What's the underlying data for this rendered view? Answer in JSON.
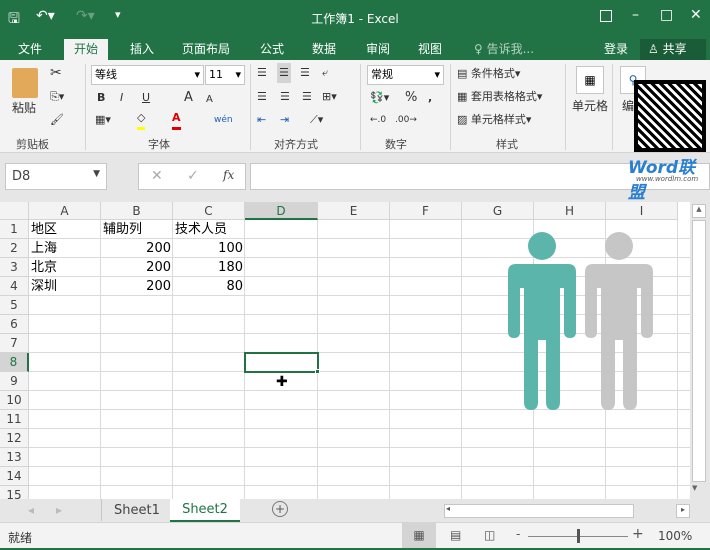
{
  "title": "工作簿1 - Excel",
  "quick_access": {
    "save": "save-icon",
    "undo": "undo-icon",
    "redo": "redo-icon",
    "customize": "▾"
  },
  "window": {
    "restore_ribbon": "ribbon-display-icon",
    "minimize": "–",
    "maximize": "□",
    "close": "✕"
  },
  "tabs": [
    "文件",
    "开始",
    "插入",
    "页面布局",
    "公式",
    "数据",
    "审阅",
    "视图"
  ],
  "tell_me": "告诉我...",
  "login": "登录",
  "share": "共享",
  "ribbon": {
    "clipboard": {
      "paste": "粘贴",
      "label": "剪贴板"
    },
    "font": {
      "name": "等线",
      "size": "11",
      "bold": "B",
      "italic": "I",
      "underline": "U",
      "grow": "A",
      "shrink": "A",
      "wen": "wén",
      "label": "字体",
      "fill_color": "#ffff00",
      "font_color": "#e00000"
    },
    "align": {
      "label": "对齐方式"
    },
    "number": {
      "format": "常规",
      "percent": "%",
      "comma": ",",
      "label": "数字"
    },
    "styles": {
      "cond": "条件格式",
      "table": "套用表格格式",
      "cell": "单元格样式",
      "label": "样式"
    },
    "cells": {
      "label": "单元格"
    },
    "edit": {
      "label": "编"
    }
  },
  "watermark": {
    "brand": "Word联盟",
    "url": "www.wordlm.com"
  },
  "formula_bar": {
    "name_box": "D8",
    "cancel": "✕",
    "enter": "✓",
    "fx": "fx",
    "value": ""
  },
  "columns": [
    "A",
    "B",
    "C",
    "D",
    "E",
    "F",
    "G",
    "H",
    "I"
  ],
  "rows": [
    "1",
    "2",
    "3",
    "4",
    "5",
    "6",
    "7",
    "8",
    "9",
    "10",
    "11",
    "12",
    "13",
    "14",
    "15"
  ],
  "cells": [
    [
      "地区",
      "辅助列",
      "技术人员"
    ],
    [
      "上海",
      "200",
      "100"
    ],
    [
      "北京",
      "200",
      "180"
    ],
    [
      "深圳",
      "200",
      "80"
    ]
  ],
  "selected_cell": "D8",
  "figures": {
    "primary_color": "#5bb5ab",
    "secondary_color": "#c6c6c6"
  },
  "sheets": [
    "Sheet1",
    "Sheet2"
  ],
  "active_sheet": "Sheet2",
  "status": {
    "ready": "就绪",
    "zoom": "100%",
    "zoom_minus": "-",
    "zoom_plus": "+"
  }
}
